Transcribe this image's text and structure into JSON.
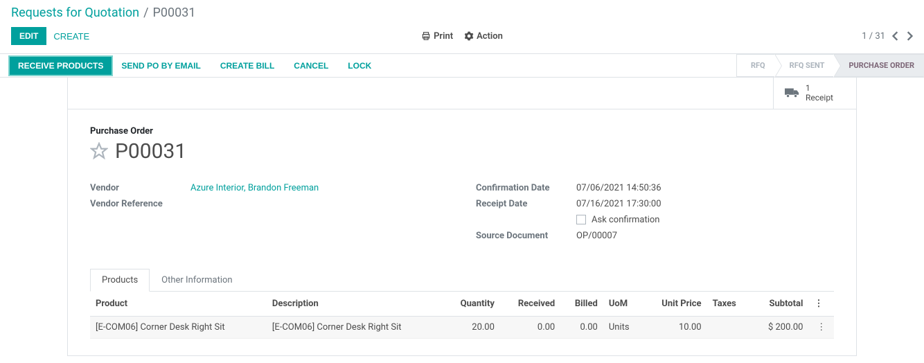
{
  "breadcrumb": {
    "parent": "Requests for Quotation",
    "sep": "/",
    "current": "P00031"
  },
  "controls": {
    "edit": "EDIT",
    "create": "CREATE",
    "print": "Print",
    "action": "Action",
    "pager": "1 / 31"
  },
  "statusbar": {
    "receive_products": "RECEIVE PRODUCTS",
    "send_po": "SEND PO BY EMAIL",
    "create_bill": "CREATE BILL",
    "cancel": "CANCEL",
    "lock": "LOCK",
    "steps": {
      "rfq": "RFQ",
      "rfq_sent": "RFQ SENT",
      "purchase_order": "PURCHASE ORDER"
    }
  },
  "stat_button": {
    "count": "1",
    "label": "Receipt"
  },
  "doc": {
    "type_label": "Purchase Order",
    "name": "P00031"
  },
  "fields_left": {
    "vendor_label": "Vendor",
    "vendor_value": "Azure Interior, Brandon Freeman",
    "vendor_ref_label": "Vendor Reference",
    "vendor_ref_value": ""
  },
  "fields_right": {
    "confirmation_label": "Confirmation Date",
    "confirmation_value": "07/06/2021 14:50:36",
    "receipt_label": "Receipt Date",
    "receipt_value": "07/16/2021 17:30:00",
    "ask_confirmation_label": "Ask confirmation",
    "source_label": "Source Document",
    "source_value": "OP/00007"
  },
  "tabs": {
    "products": "Products",
    "other": "Other Information"
  },
  "table": {
    "headers": {
      "product": "Product",
      "description": "Description",
      "quantity": "Quantity",
      "received": "Received",
      "billed": "Billed",
      "uom": "UoM",
      "unit_price": "Unit Price",
      "taxes": "Taxes",
      "subtotal": "Subtotal"
    },
    "rows": [
      {
        "product": "[E-COM06] Corner Desk Right Sit",
        "description": "[E-COM06] Corner Desk Right Sit",
        "quantity": "20.00",
        "received": "0.00",
        "billed": "0.00",
        "uom": "Units",
        "unit_price": "10.00",
        "taxes": "",
        "subtotal": "$ 200.00"
      }
    ]
  }
}
